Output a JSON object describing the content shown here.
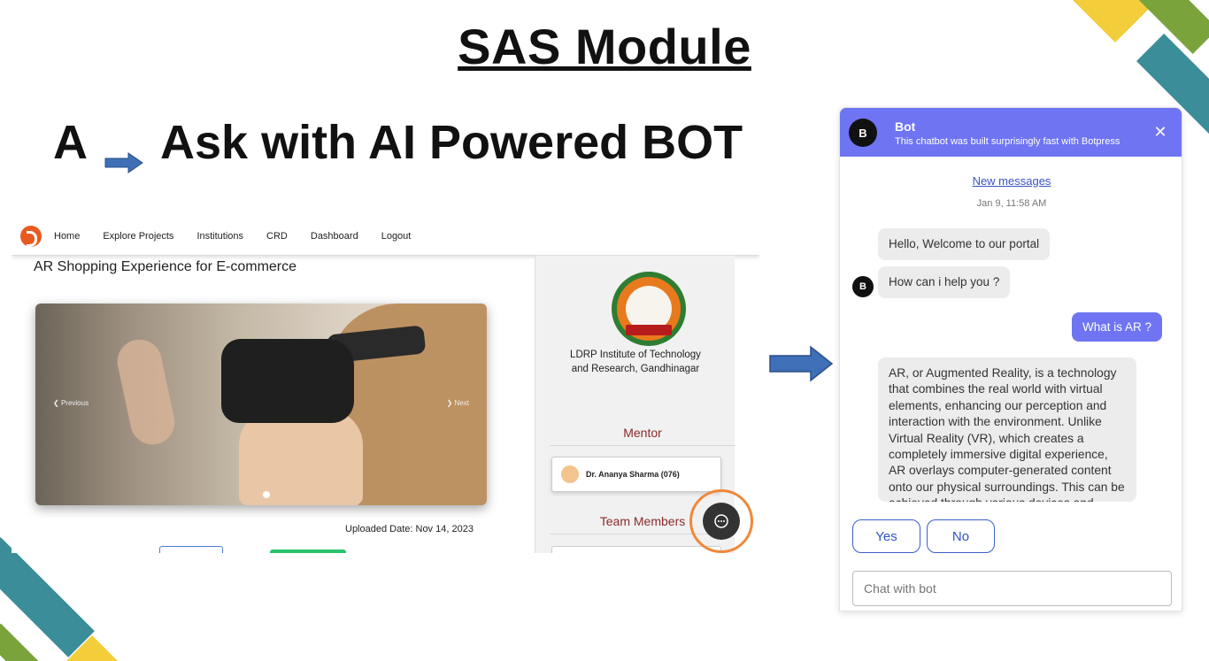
{
  "slide": {
    "title": "SAS Module",
    "heading_prefix": "A",
    "heading_text": "Ask with AI Powered BOT"
  },
  "site": {
    "nav_items": [
      "Home",
      "Explore Projects",
      "Institutions",
      "CRD",
      "Dashboard",
      "Logout"
    ],
    "project_title": "AR Shopping Experience for E-commerce",
    "carousel_prev": "Previous",
    "carousel_next": "Next",
    "uploaded_date": "Uploaded Date: Nov 14, 2023",
    "institution_name_line1": "LDRP Institute of Technology",
    "institution_name_line2": "and Research, Gandhinagar",
    "mentor_label": "Mentor",
    "mentor_name": "Dr. Ananya Sharma (076)",
    "team_label": "Team Members"
  },
  "chat": {
    "avatar_letter": "B",
    "bot_name": "Bot",
    "bot_description": "This chatbot was built surprisingly fast with Botpress",
    "new_messages_link": "New messages",
    "timestamp": "Jan 9, 11:58 AM",
    "bot_messages": [
      "Hello, Welcome to our portal",
      "How can i help you ?"
    ],
    "user_message": "What is AR ?",
    "bot_answer": "AR, or Augmented Reality, is a technology that combines the real world with virtual elements, enhancing our perception and interaction with the environment. Unlike Virtual Reality (VR), which creates a completely immersive digital experience, AR overlays computer-generated content onto our physical surroundings. This can be achieved through various devices and",
    "quick_replies": [
      "Yes",
      "No"
    ],
    "input_placeholder": "Chat with bot"
  },
  "colors": {
    "bot_accent": "#6e74f2",
    "highlight_ring": "#f0883a",
    "arrow_blue": "#3e6fb7"
  }
}
